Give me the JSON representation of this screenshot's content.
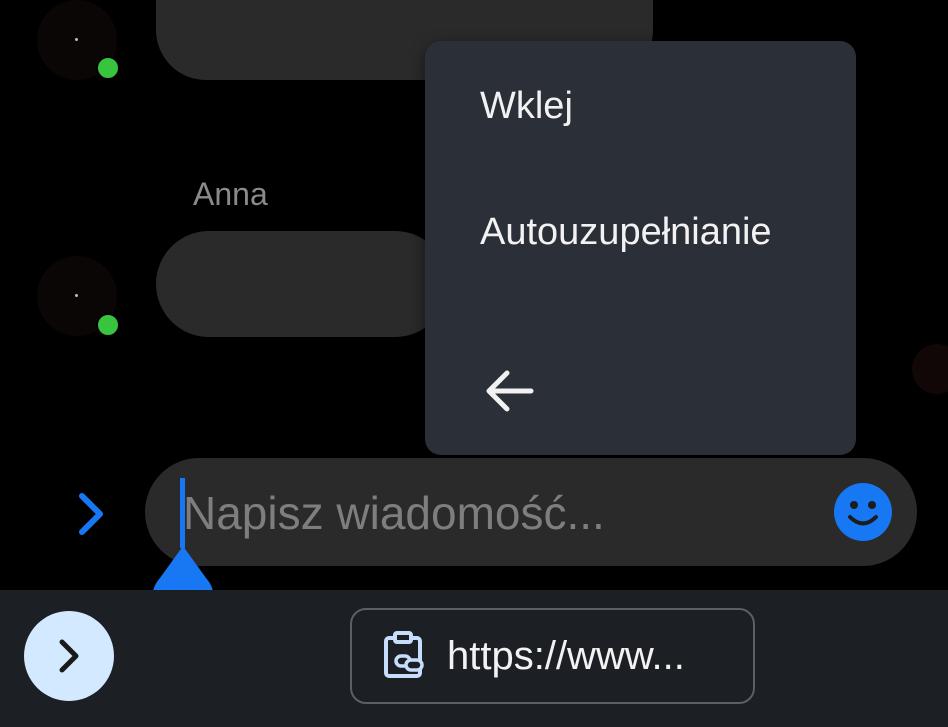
{
  "chat": {
    "sender_name": "Anna"
  },
  "context_menu": {
    "paste_label": "Wklej",
    "autofill_label": "Autouzupełnianie",
    "back_icon": "arrow-left-icon"
  },
  "composer": {
    "expand_icon": "chevron-right-icon",
    "placeholder": "Napisz wiadomość...",
    "emoji_icon": "smiley-icon"
  },
  "clipboard_bar": {
    "expand_icon": "chevron-right-icon",
    "chip_icon": "clipboard-link-icon",
    "chip_text": "https://www..."
  },
  "colors": {
    "accent": "#1877f2",
    "online": "#38c43c",
    "menu_bg": "#2b2f38",
    "bubble_bg": "#2a2a2a"
  }
}
